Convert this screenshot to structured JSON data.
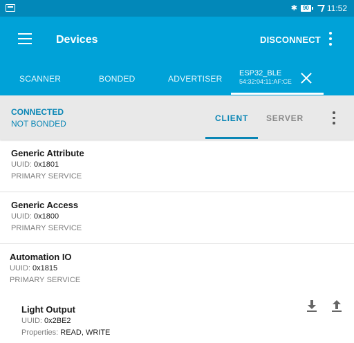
{
  "status_bar": {
    "bluetooth_icon": "bluetooth-icon",
    "battery_level": "90",
    "time": "11:52"
  },
  "app_bar": {
    "title": "Devices",
    "disconnect_label": "DISCONNECT"
  },
  "tabs": {
    "scanner": "SCANNER",
    "bonded": "BONDED",
    "advertiser": "ADVERTISER",
    "device_name": "ESP32_BLE",
    "device_address": "54:32:04:11:AF:CE"
  },
  "connection": {
    "state": "CONNECTED",
    "bond_state": "NOT BONDED",
    "client_label": "CLIENT",
    "server_label": "SERVER"
  },
  "colors": {
    "primary": "#00a2d8",
    "status_bar": "#0288b9",
    "accent_text": "#0a86b5",
    "secondary_bar": "#e9e9e9"
  },
  "services": [
    {
      "name": "Generic Attribute",
      "uuid_label": "UUID:",
      "uuid": "0x1801",
      "type": "PRIMARY SERVICE"
    },
    {
      "name": "Generic Access",
      "uuid_label": "UUID:",
      "uuid": "0x1800",
      "type": "PRIMARY SERVICE"
    },
    {
      "name": "Automation IO",
      "uuid_label": "UUID:",
      "uuid": "0x1815",
      "type": "PRIMARY SERVICE"
    }
  ],
  "characteristic": {
    "name": "Light Output",
    "uuid_label": "UUID:",
    "uuid": "0x2BE2",
    "properties_label": "Properties:",
    "properties": "READ, WRITE",
    "read_icon": "download-icon",
    "write_icon": "upload-icon"
  }
}
